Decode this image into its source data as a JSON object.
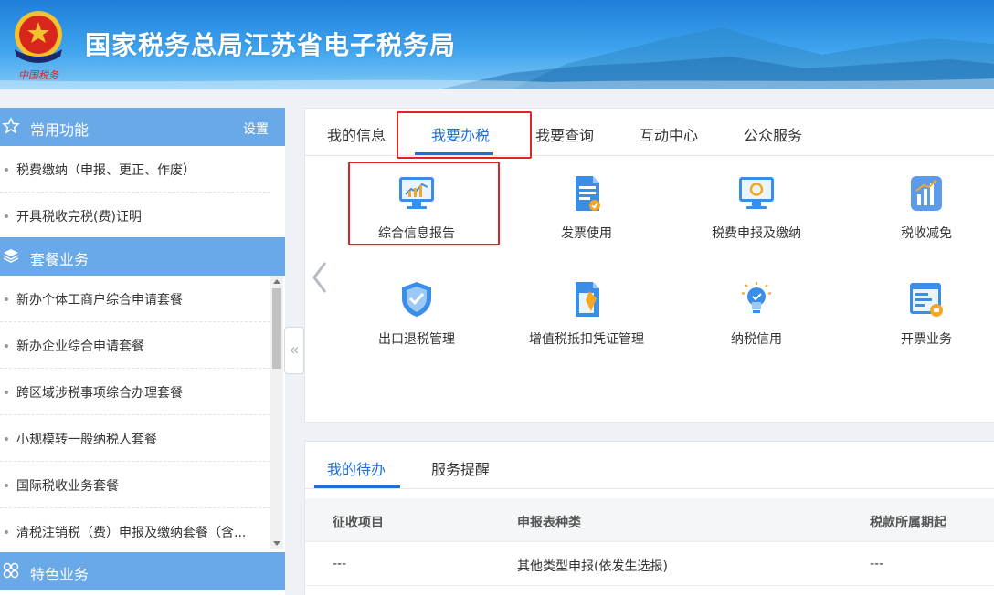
{
  "header": {
    "title": "国家税务总局江苏省电子税务局",
    "logo_text": "中国税务"
  },
  "sidebar": {
    "sections": [
      {
        "title": "常用功能",
        "icon": "star-outline-icon",
        "action": "设置",
        "items": [
          "税费缴纳（申报、更正、作废）",
          "开具税收完税(费)证明"
        ]
      },
      {
        "title": "套餐业务",
        "icon": "layers-icon",
        "items": [
          "新办个体工商户综合申请套餐",
          "新办企业综合申请套餐",
          "跨区域涉税事项综合办理套餐",
          "小规模转一般纳税人套餐",
          "国际税收业务套餐",
          "清税注销税（费）申报及缴纳套餐（含..."
        ]
      },
      {
        "title": "特色业务",
        "icon": "clover-grid-icon",
        "items": []
      }
    ],
    "collapse_label": "«"
  },
  "main": {
    "tabs": [
      "我的信息",
      "我要办税",
      "我要查询",
      "互动中心",
      "公众服务"
    ],
    "active_tab": "我要办税",
    "tiles": [
      {
        "label": "综合信息报告",
        "icon": "monitor-chart-icon"
      },
      {
        "label": "发票使用",
        "icon": "invoice-document-icon"
      },
      {
        "label": "税费申报及缴纳",
        "icon": "monitor-refresh-icon"
      },
      {
        "label": "税收减免",
        "icon": "bar-chart-icon"
      },
      {
        "label": "出口退税管理",
        "icon": "shield-check-icon"
      },
      {
        "label": "增值税抵扣凭证管理",
        "icon": "document-pen-icon"
      },
      {
        "label": "纳税信用",
        "icon": "lightbulb-icon"
      },
      {
        "label": "开票业务",
        "icon": "browser-form-icon"
      }
    ]
  },
  "todo": {
    "tabs": [
      "我的待办",
      "服务提醒"
    ],
    "active_tab": "我的待办",
    "columns": [
      "征收项目",
      "申报表种类",
      "税款所属期起"
    ],
    "rows": [
      [
        "---",
        "其他类型申报(依发生选报)",
        "---"
      ]
    ]
  },
  "colors": {
    "accent": "#1d6fd6",
    "sidebar_header": "#6aa9e8",
    "highlight": "#e02424"
  }
}
